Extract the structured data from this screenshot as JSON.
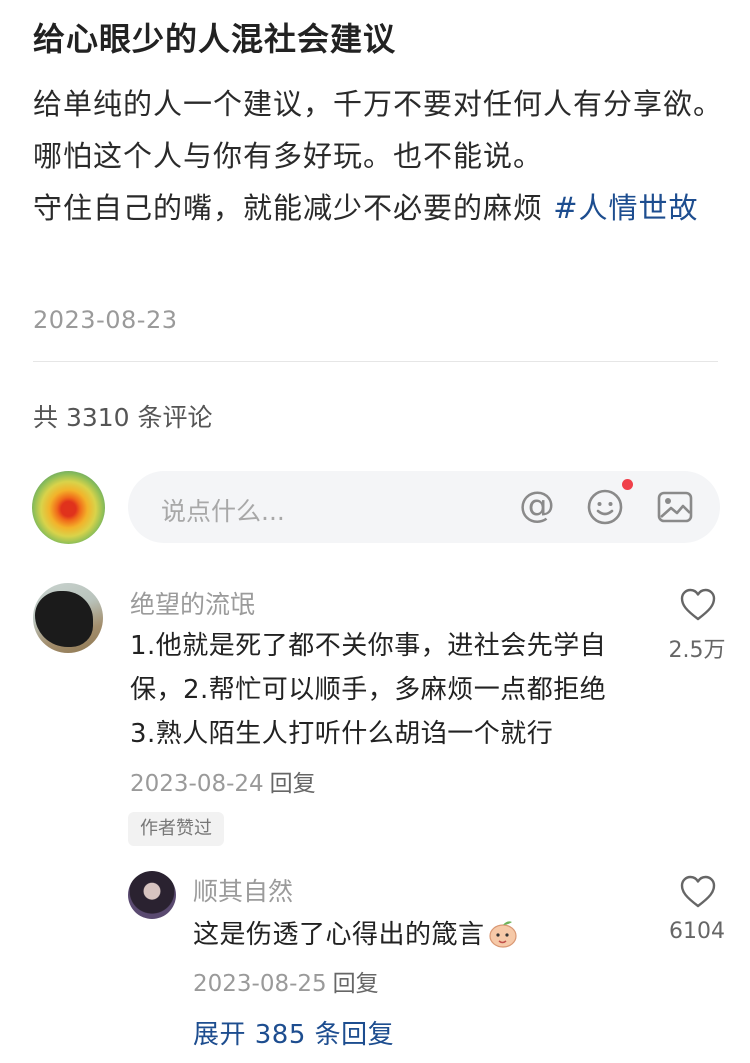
{
  "post": {
    "title": "给心眼少的人混社会建议",
    "body_line1": "给单纯的人一个建议，千万不要对任何人有分享欲。哪怕这个人与你有多好玩。也不能说。",
    "body_line2": "守住自己的嘴，就能减少不必要的麻烦 ",
    "hashtag": "#人情世故",
    "date": "2023-08-23"
  },
  "comments_header": {
    "count_text": "共 3310 条评论"
  },
  "composer": {
    "placeholder": "说点什么...",
    "icons": [
      "at-icon",
      "emoji-icon",
      "image-icon"
    ],
    "notification_dot_color": "#f0404a"
  },
  "comment": {
    "author": "绝望的流氓",
    "lines": [
      "1.他就是死了都不关你事，进社会先学自保，2.帮忙可以顺手，多麻烦一点都拒绝",
      "3.熟人陌生人打听什么胡诌一个就行"
    ],
    "date": "2023-08-24",
    "reply_label": "回复",
    "badge": "作者赞过",
    "like_count": "2.5万"
  },
  "reply": {
    "author": "顺其自然",
    "text": "这是伤透了心得出的箴言",
    "date": "2023-08-25",
    "reply_label": "回复",
    "like_count": "6104",
    "expand_label": "展开 385 条回复"
  },
  "colors": {
    "link": "#1d4d8f",
    "muted": "#9a9a9a"
  }
}
